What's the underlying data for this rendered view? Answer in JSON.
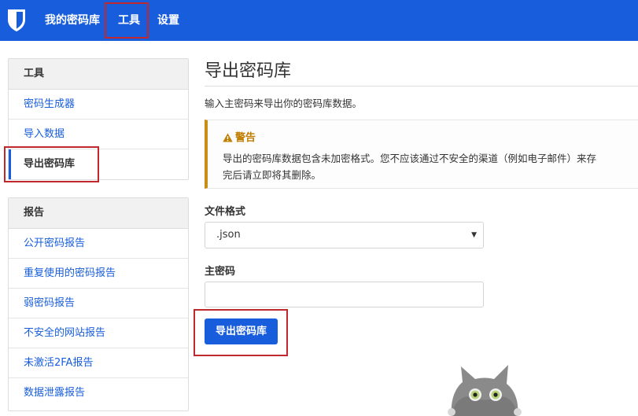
{
  "navbar": {
    "logo": "bitwarden-shield-icon",
    "links": [
      {
        "label": "我的密码库"
      },
      {
        "label": "工具",
        "active": true
      },
      {
        "label": "设置"
      }
    ]
  },
  "sidebar": {
    "tools": {
      "heading": "工具",
      "items": [
        {
          "label": "密码生成器"
        },
        {
          "label": "导入数据"
        },
        {
          "label": "导出密码库",
          "active": true
        }
      ]
    },
    "reports": {
      "heading": "报告",
      "items": [
        {
          "label": "公开密码报告"
        },
        {
          "label": "重复使用的密码报告"
        },
        {
          "label": "弱密码报告"
        },
        {
          "label": "不安全的网站报告"
        },
        {
          "label": "未激活2FA报告"
        },
        {
          "label": "数据泄露报告"
        }
      ]
    }
  },
  "main": {
    "title": "导出密码库",
    "intro": "输入主密码来导出你的密码库数据。",
    "warning": {
      "icon": "warning-triangle-icon",
      "title": "警告",
      "line1": "导出的密码库数据包含未加密格式。您不应该通过不安全的渠道（例如电子邮件）来存",
      "line2": "完后请立即将其删除。"
    },
    "format": {
      "label": "文件格式",
      "value": ".json"
    },
    "master_password": {
      "label": "主密码",
      "value": ""
    },
    "submit_label": "导出密码库"
  },
  "colors": {
    "brand": "#175ddc",
    "warning": "#c98e16",
    "annotation": "#c0282e"
  }
}
